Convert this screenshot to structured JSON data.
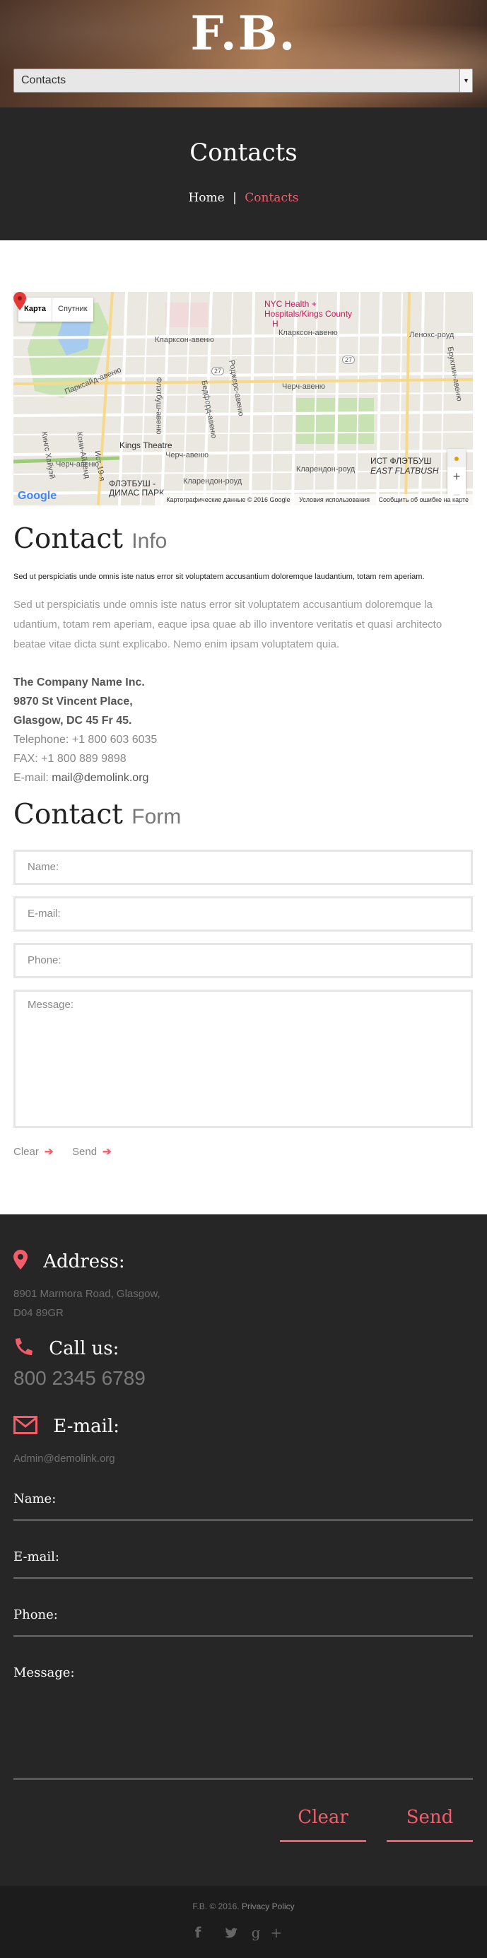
{
  "header": {
    "brand": "F.B.",
    "nav_select_value": "Contacts"
  },
  "page": {
    "title": "Contacts",
    "breadcrumb": {
      "home": "Home",
      "separator": "|",
      "current": "Contacts"
    }
  },
  "map": {
    "type_buttons": [
      "Карта",
      "Спутник"
    ],
    "labels": {
      "nyc_health": "NYC Health +",
      "hospitals": "Hospitals/Kings County",
      "h": "H",
      "clarkson": "Кларксон-авеню",
      "clarkson2": "Кларксон-авеню",
      "lenox": "Ленокс-роуд",
      "parkside": "Парксайд-авеню",
      "flatbush": "Флэтбуш-авеню",
      "bedford": "Бедфорд-авеню",
      "rogers": "Роджерс-авеню",
      "church": "Черч-авеню",
      "church2": "Черч-авеню",
      "church3": "Черч-авеню",
      "kings_theatre": "Kings Theatre",
      "clarendon": "Кларендон-роуд",
      "clarendon2": "Кларендон-роуд",
      "east_flatbush_ru": "ИСТ ФЛЭТБУШ",
      "east_flatbush": "EAST FLATBUSH",
      "flatbush_ditmas": "ФЛЭТБУШ -",
      "ditmas_park": "ДИМАС ПАРК",
      "kings_hwy": "Кингс Хайуэй",
      "coney": "Кони-Айленд",
      "east_19": "Ист 19-я",
      "brooklyn": "Бруклин-авеню",
      "route_27": "27",
      "route_27b": "27"
    },
    "zoom_in": "+",
    "zoom_out": "−",
    "logo": "Google",
    "footer_data": "Картографические данные © 2016 Google",
    "footer_terms": "Условия использования",
    "footer_report": "Сообщить об ошибке на карте"
  },
  "contact_info": {
    "title_main": "Contact",
    "title_light": "Info",
    "lead": "Sed ut perspiciatis unde omnis iste natus error sit voluptatem accusantium doloremque laudantium, totam rem aperiam.",
    "paragraph": "Sed ut perspiciatis unde omnis iste natus error sit voluptatem accusantium doloremque la udantium, totam rem aperiam, eaque ipsa quae ab illo inventore veritatis et quasi architecto beatae vitae dicta sunt explicabo. Nemo enim ipsam voluptatem quia.",
    "company": "The Company Name Inc.",
    "street": "9870 St Vincent Place,",
    "city": "Glasgow, DC 45 Fr 45.",
    "telephone": "Telephone: +1 800 603 6035",
    "fax": "FAX: +1 800 889 9898",
    "email_label": "E-mail: ",
    "email": "mail@demolink.org"
  },
  "contact_form": {
    "title_main": "Contact",
    "title_light": "Form",
    "name_placeholder": "Name:",
    "email_placeholder": "E-mail:",
    "phone_placeholder": "Phone:",
    "message_placeholder": "Message:",
    "clear_label": "Clear",
    "send_label": "Send"
  },
  "footer_info": {
    "address_title": "Address:",
    "address_line1": "8901 Marmora Road, Glasgow,",
    "address_line2": "D04 89GR",
    "call_title": "Call us:",
    "phone": "800 2345 6789",
    "email_title": "E-mail:",
    "email": "Admin@demolink.org"
  },
  "footer_form": {
    "name_label": "Name:",
    "email_label": "E-mail:",
    "phone_label": "Phone:",
    "message_label": "Message:",
    "clear_label": "Clear",
    "send_label": "Send"
  },
  "bottom": {
    "copyright": "F.B. © 2016.",
    "privacy": "Privacy Policy",
    "social_icons": [
      "facebook-icon",
      "twitter-icon",
      "google-plus-icon"
    ]
  },
  "colors": {
    "accent": "#f35d6a",
    "dark_bg": "#272727",
    "bottom_bg": "#1c1c1c"
  }
}
